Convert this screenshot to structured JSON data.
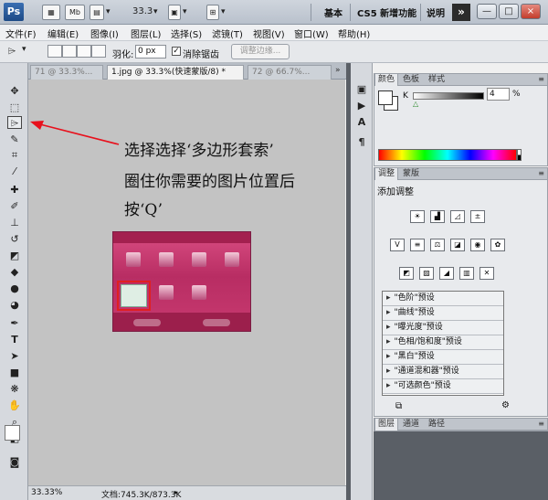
{
  "titlebar": {
    "logo": "Ps",
    "mb_label": "Mb",
    "zoom": "33.3",
    "workspaces": [
      "基本",
      "CS5 新增功能",
      "说明"
    ],
    "more_label": "»",
    "min_label": "—",
    "max_label": "□",
    "close_label": "×"
  },
  "menu": [
    "文件(F)",
    "编辑(E)",
    "图像(I)",
    "图层(L)",
    "选择(S)",
    "滤镜(T)",
    "视图(V)",
    "窗口(W)",
    "帮助(H)"
  ],
  "options": {
    "feather_label": "羽化:",
    "feather_value": "0 px",
    "antialias_label": "消除锯齿",
    "antialias_checked": "✓",
    "refine_label": "调整边缘..."
  },
  "tabs": [
    "71 @ 33.3%...",
    "1.jpg @ 33.3%(快速蒙版/8) *",
    "72 @ 66.7%..."
  ],
  "annotation": {
    "line1": "选择选择‘多边形套索’",
    "line2": "圈住你需要的图片位置后",
    "line3": "按‘Q’"
  },
  "status": {
    "zoom": "33.33%",
    "doc": "文档:745.3K/873.3K"
  },
  "color_panel": {
    "tabs": [
      "颜色",
      "色板",
      "样式"
    ],
    "k_label": "K",
    "k_value": "4",
    "k_unit": "%"
  },
  "adjust_panel": {
    "tabs": [
      "调整",
      "蒙版"
    ],
    "title": "添加调整",
    "presets": [
      "\"色阶\"预设",
      "\"曲线\"预设",
      "\"曝光度\"预设",
      "\"色相/饱和度\"预设",
      "\"黑白\"预设",
      "\"通道混和器\"预设",
      "\"可选颜色\"预设"
    ]
  },
  "layers_panel": {
    "tabs": [
      "图层",
      "通道",
      "路径"
    ]
  },
  "colors": {
    "annotation_arrow": "#e8101c",
    "thumb_pink": "#c83a70"
  }
}
